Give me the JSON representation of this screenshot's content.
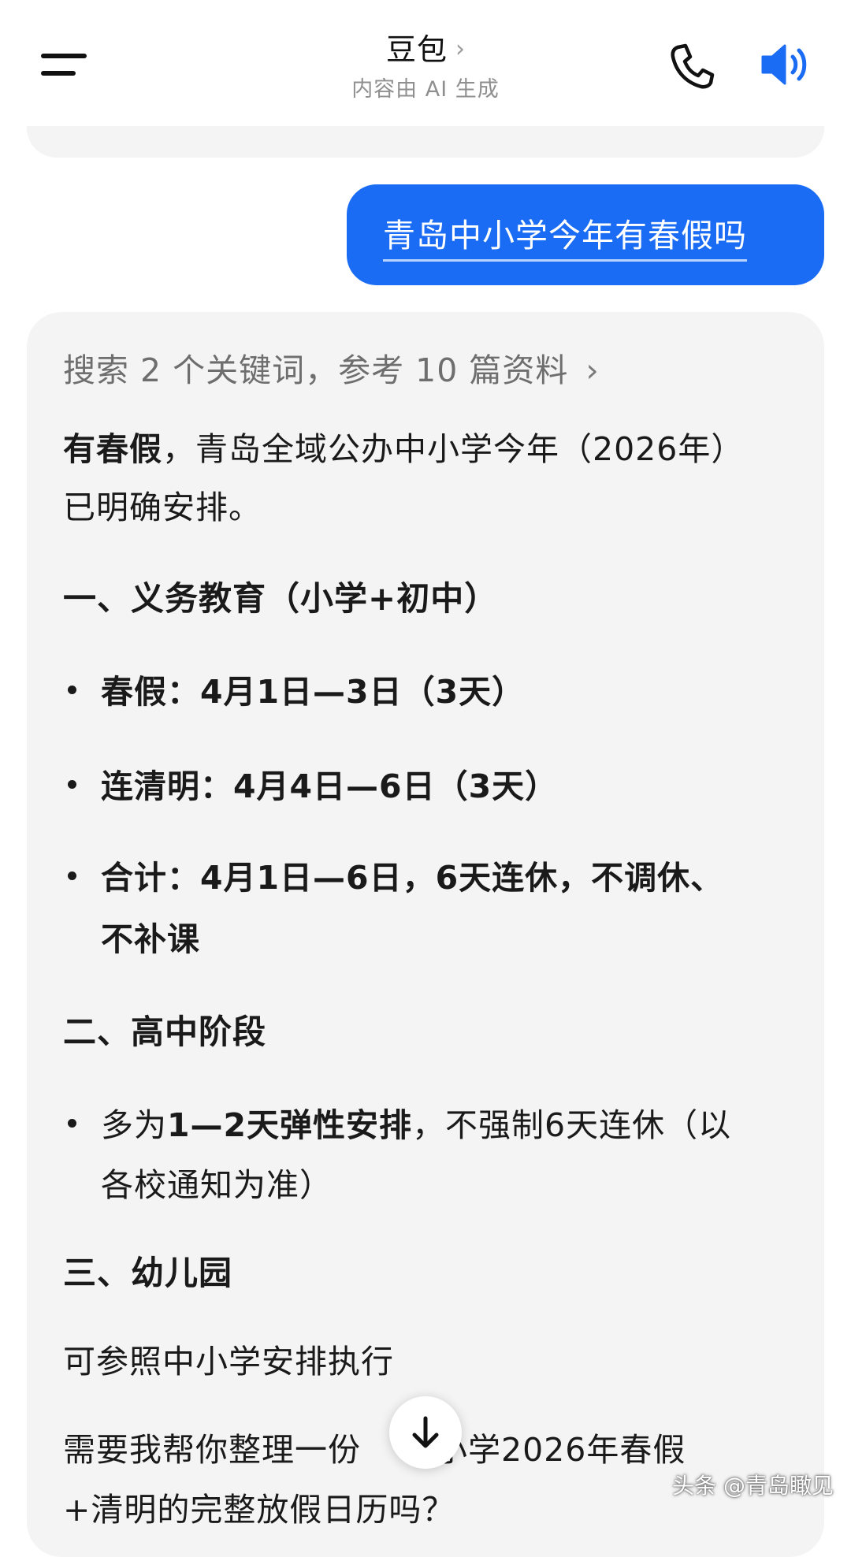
{
  "header": {
    "title": "豆包",
    "title_chevron": "›",
    "subtitle": "内容由 AI 生成",
    "icons": [
      "menu-icon",
      "phone-icon",
      "speaker-icon"
    ],
    "accent_color": "#1a6cf5"
  },
  "chat": {
    "user_message": "青岛中小学今年有春假吗",
    "search_ref": "搜索 2 个关键词，参考 10 篇资料",
    "search_ref_chevron": "›",
    "answer": {
      "intro_bold": "有春假",
      "intro_rest": "，青岛全域公办中小学今年（2026年）",
      "intro_line2": "已明确安排。",
      "section1_heading": "一、义务教育（小学+初中）",
      "s1_bullet1": "春假：4月1日—3日（3天）",
      "s1_bullet2": "连清明：4月4日—6日（3天）",
      "s1_bullet3_line1": "合计：4月1日—6日，6天连休，不调休、",
      "s1_bullet3_line2": "不补课",
      "section2_heading": "二、高中阶段",
      "s2_bullet1_pre": "多为",
      "s2_bullet1_bold": "1—2天弹性安排",
      "s2_bullet1_post": "，不强制6天连休（以",
      "s2_bullet1_line2": "各校通知为准）",
      "section3_heading": "三、幼儿园",
      "s3_text": "可参照中小学安排执行",
      "closing_line1_a": "需要我帮你整理一份",
      "closing_line1_b": "中小学2026年春假",
      "closing_line2": "+清明的完整放假日历吗？"
    }
  },
  "scroll_button_icon": "arrow-down-icon",
  "watermark": "头条 @青岛瞰见"
}
